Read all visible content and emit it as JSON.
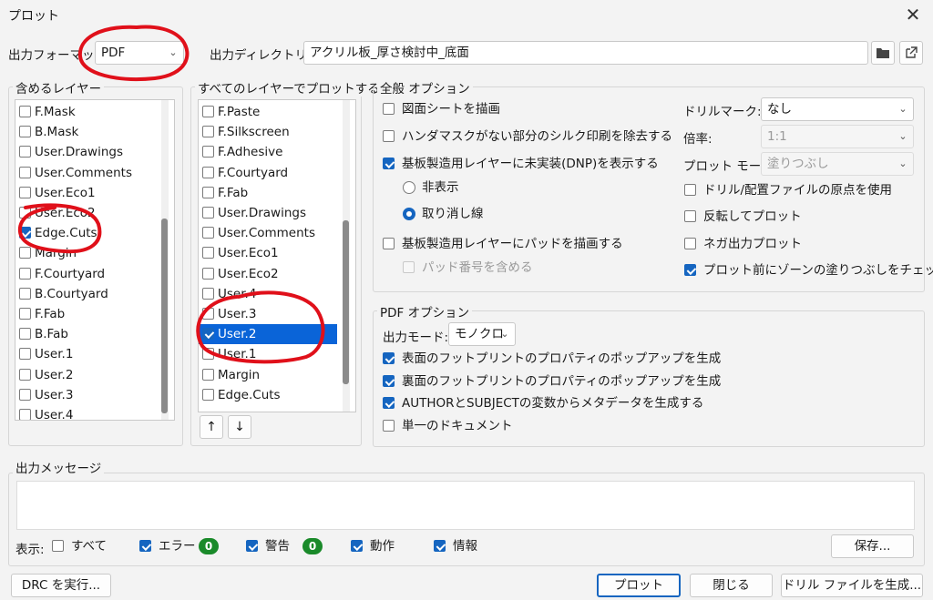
{
  "window": {
    "title": "プロット"
  },
  "top": {
    "format_label": "出力フォーマット:",
    "format_value": "PDF",
    "dir_label": "出力ディレクトリ:",
    "dir_value": "アクリル板_厚さ検討中_底面"
  },
  "include_layers": {
    "title": "含めるレイヤー",
    "items": [
      {
        "label": "F.Mask",
        "checked": false
      },
      {
        "label": "B.Mask",
        "checked": false
      },
      {
        "label": "User.Drawings",
        "checked": false
      },
      {
        "label": "User.Comments",
        "checked": false
      },
      {
        "label": "User.Eco1",
        "checked": false
      },
      {
        "label": "User.Eco2",
        "checked": false
      },
      {
        "label": "Edge.Cuts",
        "checked": true
      },
      {
        "label": "Margin",
        "checked": false
      },
      {
        "label": "F.Courtyard",
        "checked": false
      },
      {
        "label": "B.Courtyard",
        "checked": false
      },
      {
        "label": "F.Fab",
        "checked": false
      },
      {
        "label": "B.Fab",
        "checked": false
      },
      {
        "label": "User.1",
        "checked": false
      },
      {
        "label": "User.2",
        "checked": false
      },
      {
        "label": "User.3",
        "checked": false
      },
      {
        "label": "User.4",
        "checked": false
      }
    ]
  },
  "all_layers": {
    "title": "すべてのレイヤーでプロットする",
    "items": [
      {
        "label": "F.Paste",
        "checked": false
      },
      {
        "label": "F.Silkscreen",
        "checked": false
      },
      {
        "label": "F.Adhesive",
        "checked": false
      },
      {
        "label": "F.Courtyard",
        "checked": false
      },
      {
        "label": "F.Fab",
        "checked": false
      },
      {
        "label": "User.Drawings",
        "checked": false
      },
      {
        "label": "User.Comments",
        "checked": false
      },
      {
        "label": "User.Eco1",
        "checked": false
      },
      {
        "label": "User.Eco2",
        "checked": false
      },
      {
        "label": "User.4",
        "checked": false
      },
      {
        "label": "User.3",
        "checked": false
      },
      {
        "label": "User.2",
        "checked": true,
        "selected": true
      },
      {
        "label": "User.1",
        "checked": false
      },
      {
        "label": "Margin",
        "checked": false
      },
      {
        "label": "Edge.Cuts",
        "checked": false
      }
    ],
    "up_icon": "arrow-up-icon",
    "down_icon": "arrow-down-icon"
  },
  "general": {
    "title": "全般 オプション",
    "draw_sheet": "図面シートを描画",
    "no_silk_on_mask": "ハンダマスクがない部分のシルク印刷を除去する",
    "show_dnp": "基板製造用レイヤーに未実装(DNP)を表示する",
    "hide": "非表示",
    "strike": "取り消し線",
    "draw_pads": "基板製造用レイヤーにパッドを描画する",
    "include_pad_numbers": "パッド番号を含める",
    "drill_marks_label": "ドリルマーク:",
    "drill_marks_value": "なし",
    "scale_label": "倍率:",
    "scale_value": "1:1",
    "plot_mode_label": "プロット モード:",
    "plot_mode_value": "塗りつぶし",
    "use_drill_origin": "ドリル/配置ファイルの原点を使用",
    "mirror": "反転してプロット",
    "negative": "ネガ出力プロット",
    "check_zone_fill": "プロット前にゾーンの塗りつぶしをチェック"
  },
  "pdf": {
    "title": "PDF オプション",
    "output_mode_label": "出力モード:",
    "output_mode_value": "モノクロ",
    "front_popups": "表面のフットプリントのプロパティのポップアップを生成",
    "back_popups": "裏面のフットプリントのプロパティのポップアップを生成",
    "metadata": "AUTHORとSUBJECTの変数からメタデータを生成する",
    "single_doc": "単一のドキュメント"
  },
  "messages": {
    "title": "出力メッセージ",
    "show_label": "表示:",
    "all": "すべて",
    "errors": "エラー",
    "errors_count": "0",
    "warnings": "警告",
    "warnings_count": "0",
    "actions": "動作",
    "info": "情報",
    "save": "保存..."
  },
  "footer": {
    "run_drc": "DRC を実行...",
    "plot": "プロット",
    "close": "閉じる",
    "drill_files": "ドリル ファイルを生成..."
  },
  "colors": {
    "accent": "#1565c0",
    "annotation": "#e0101a",
    "badge": "#1a8a2a"
  }
}
